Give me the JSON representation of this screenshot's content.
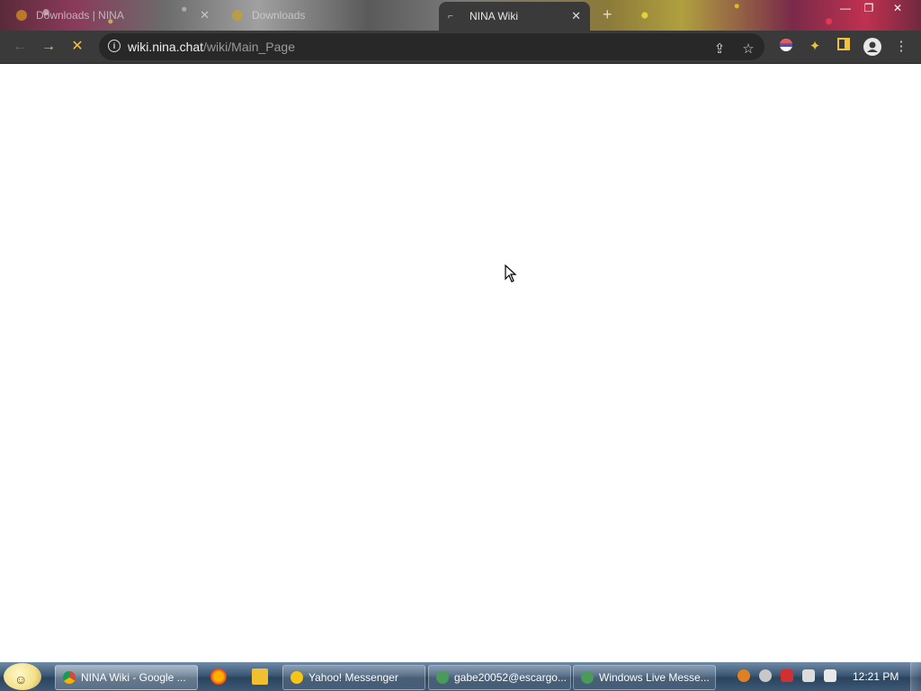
{
  "browser": {
    "tabs": [
      {
        "title": "Downloads | NINA",
        "state": "inactive"
      },
      {
        "title": "Downloads",
        "state": "inactive"
      },
      {
        "title": "NINA Wiki",
        "state": "active"
      }
    ],
    "new_tab_glyph": "+",
    "close_glyph": "✕",
    "window_controls": {
      "minimize": "—",
      "restore": "❐",
      "close": "✕"
    },
    "url": {
      "host": "wiki.nina.chat",
      "path": "/wiki/Main_Page"
    },
    "nav": {
      "back": "←",
      "forward": "→",
      "reload": "✕"
    },
    "toolbar_icons": [
      "share-icon",
      "star-icon",
      "flag-icon",
      "extensions-icon",
      "sidebar-icon",
      "profile-icon",
      "menu-icon"
    ]
  },
  "taskbar": {
    "items": [
      {
        "label": "NINA Wiki - Google ...",
        "icon": "chrome-icon",
        "active": true
      },
      {
        "label": "Yahoo! Messenger",
        "icon": "yahoo-icon",
        "active": false
      },
      {
        "label": "gabe20052@escargo...",
        "icon": "msn-icon",
        "active": false
      },
      {
        "label": "Windows Live Messe...",
        "icon": "msn-icon",
        "active": false
      }
    ],
    "quick_launch": [
      "firefox-icon",
      "folder-icon"
    ],
    "clock": "12:21 PM"
  },
  "colors": {
    "accent": "#f0c040",
    "titlebar": "#3a3a3a",
    "taskbar": "#3d5875"
  }
}
